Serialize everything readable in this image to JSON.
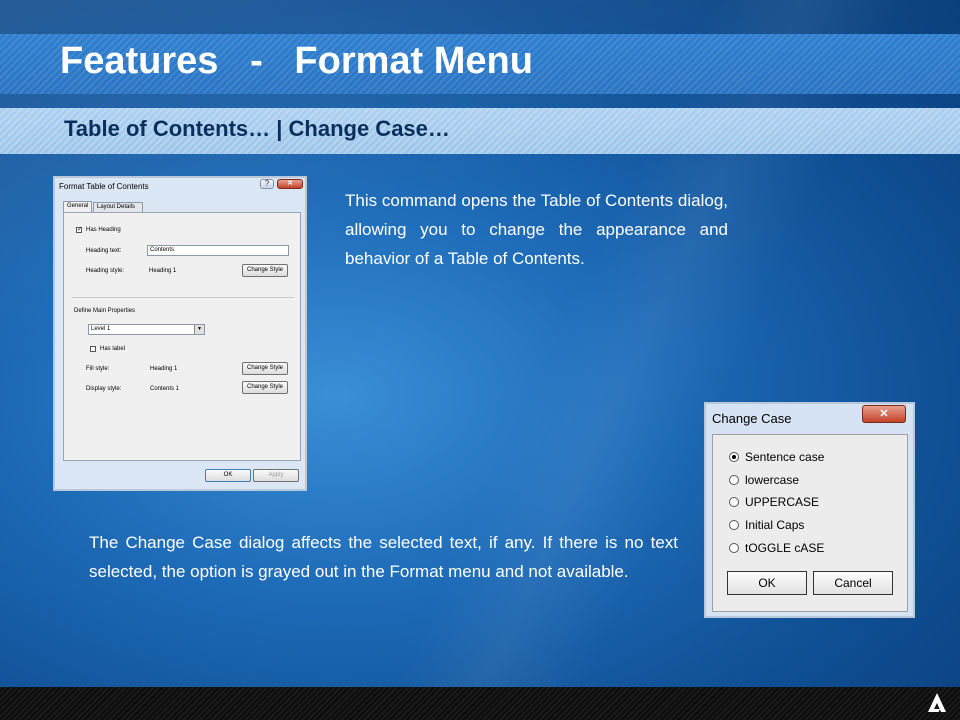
{
  "slide": {
    "title": "Features   -   Format Menu",
    "subtitle": "Table of Contents… | Change Case…",
    "paragraph1": "This command opens the Table of Contents dialog, allowing you to change the appearance and behavior of a Table of Contents.",
    "paragraph2": "The Change Case dialog affects the selected text, if any. If there is no text selected, the option is grayed out in the Format menu and not available.",
    "logo_icon": "logo-a-icon"
  },
  "toc_dialog": {
    "title": "Format Table of Contents",
    "help": "?",
    "close": "✕",
    "tabs": [
      "General",
      "Layout Details"
    ],
    "has_heading_label": "Has Heading",
    "has_heading_checked": true,
    "heading_text_label": "Heading text:",
    "heading_text_value": "Contents",
    "heading_style_label": "Heading style:",
    "heading_style_value": "Heading 1",
    "change_style_label": "Change Style",
    "define_main_label": "Define Main Properties",
    "level_value": "Level 1",
    "has_label_label": "Has label",
    "has_label_checked": false,
    "fill_style_label": "Fill style:",
    "fill_style_value": "Heading 1",
    "display_style_label": "Display style:",
    "display_style_value": "Contents 1",
    "ok_label": "OK",
    "apply_label": "Apply"
  },
  "change_case_dialog": {
    "title": "Change Case",
    "close": "✕",
    "options": [
      "Sentence case",
      "lowercase",
      "UPPERCASE",
      "Initial Caps",
      "tOGGLE cASE"
    ],
    "selected_index": 0,
    "ok_label": "OK",
    "cancel_label": "Cancel"
  }
}
